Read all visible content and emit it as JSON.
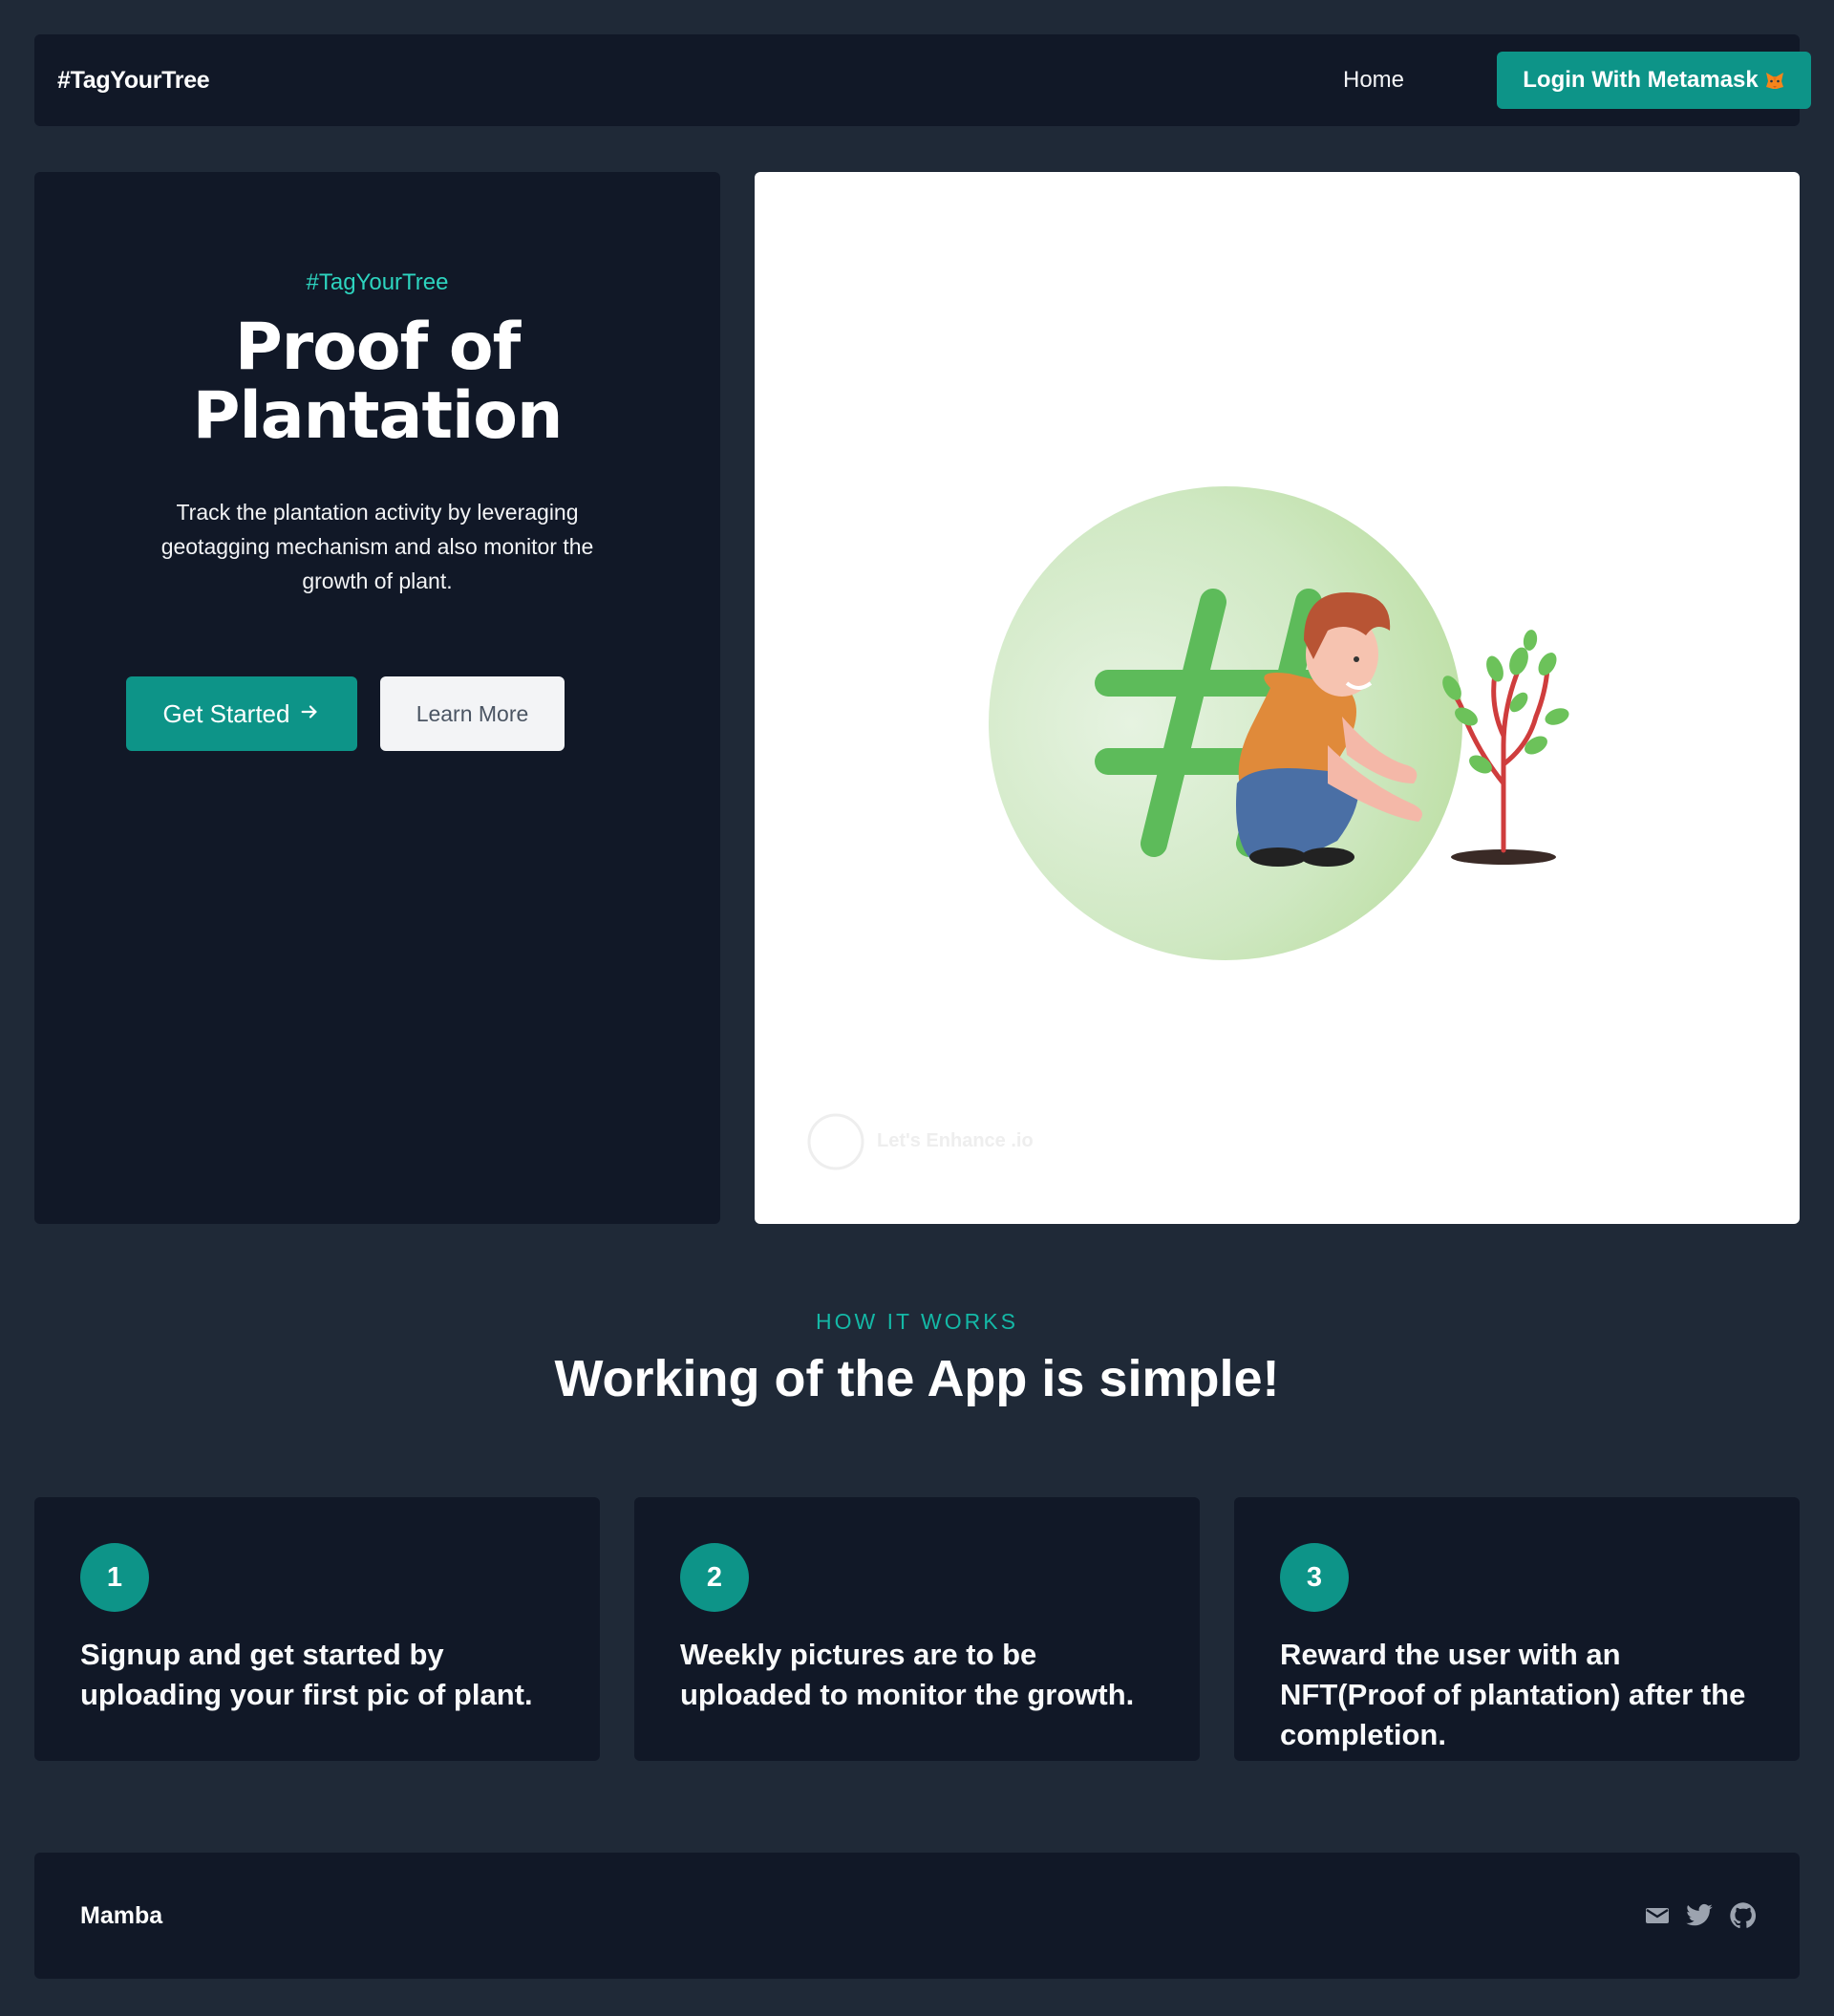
{
  "header": {
    "brand": "#TagYourTree",
    "nav_home": "Home",
    "login_label": "Login With Metamask"
  },
  "hero": {
    "tag": "#TagYourTree",
    "title_line1": "Proof of",
    "title_line2": "Plantation",
    "description": "Track the plantation activity by leveraging geotagging mechanism and also monitor the growth of plant.",
    "get_started_label": "Get Started",
    "learn_more_label": "Learn More",
    "image_icon": "boy-planting-tree-illustration",
    "watermark": "Let's Enhance .io"
  },
  "how_it_works": {
    "label": "HOW IT WORKS",
    "title": "Working of the App is simple!",
    "steps": [
      {
        "number": "1",
        "text": "Signup and get started by uploading your first pic of plant."
      },
      {
        "number": "2",
        "text": "Weekly pictures are to be uploaded to monitor the growth."
      },
      {
        "number": "3",
        "text": "Reward the user with an NFT(Proof of plantation) after the completion."
      }
    ]
  },
  "footer": {
    "brand": "Mamba",
    "icons": [
      "mail-icon",
      "twitter-icon",
      "github-icon"
    ]
  },
  "colors": {
    "page_bg": "#1f2937",
    "panel_bg": "#111827",
    "accent": "#0d9488",
    "accent_text": "#2dd4bf"
  }
}
